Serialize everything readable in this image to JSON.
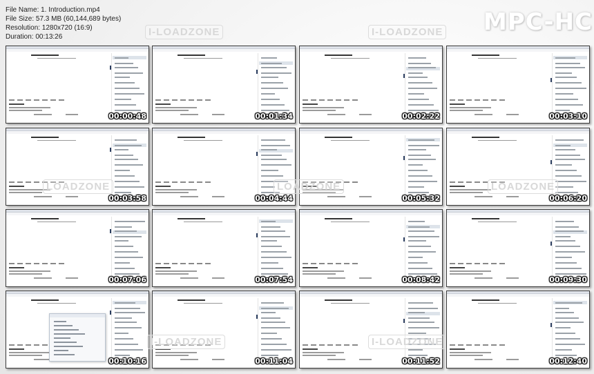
{
  "info": {
    "file_name": "File Name: 1. Introduction.mp4",
    "file_size": "File Size: 57.3 MB (60,144,689 bytes)",
    "resolution": "Resolution: 1280x720 (16:9)",
    "duration": "Duration: 00:13:26"
  },
  "brand": "MPC-HC",
  "watermark": "I-LOADZONE",
  "watermark_partial": "LOADZONE",
  "thumbnails": [
    {
      "time": "00:00:48"
    },
    {
      "time": "00:01:34"
    },
    {
      "time": "00:02:22"
    },
    {
      "time": "00:03:10"
    },
    {
      "time": "00:03:58"
    },
    {
      "time": "00:04:44"
    },
    {
      "time": "00:05:32"
    },
    {
      "time": "00:06:20"
    },
    {
      "time": "00:07:06"
    },
    {
      "time": "00:07:54"
    },
    {
      "time": "00:08:42"
    },
    {
      "time": "00:09:30"
    },
    {
      "time": "00:10:16"
    },
    {
      "time": "00:11:04"
    },
    {
      "time": "00:11:52"
    },
    {
      "time": "00:12:40"
    }
  ],
  "dialog_thumbnail_index": 12
}
